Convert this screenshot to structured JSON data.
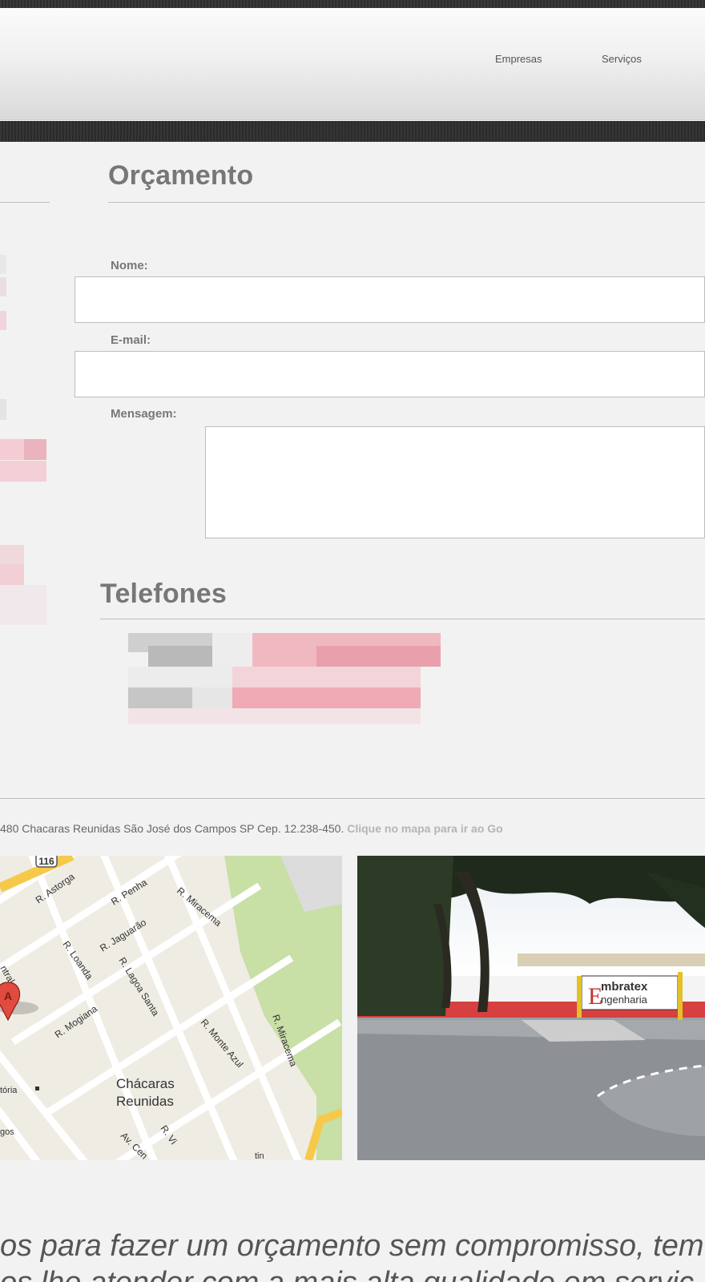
{
  "nav": {
    "items": [
      {
        "label": "Empresas"
      },
      {
        "label": "Serviços"
      }
    ]
  },
  "orcamento": {
    "title": "Orçamento",
    "name_label": "Nome:",
    "email_label": "E-mail:",
    "message_label": "Mensagem:",
    "name_value": "",
    "email_value": "",
    "message_value": ""
  },
  "telefones": {
    "title": "Telefones"
  },
  "footer": {
    "address": "480 Chacaras Reunidas São José dos Campos SP Cep. 12.238-450. ",
    "map_hint": "Clique no mapa para ir ao Go"
  },
  "map": {
    "route_badge": "116",
    "marker_letter": "A",
    "area_name_line1": "Chácaras",
    "area_name_line2": "Reunidas",
    "streets": [
      "R. Astorga",
      "R. Penha",
      "R. Miracema",
      "R. Loanda",
      "R. Jaguarão",
      "R. Lagoa Santa",
      "R. Mogiana",
      "R. Monte Azul",
      "R. Miracema",
      "R. Vi",
      "Av. Cen",
      "ntral",
      "tória",
      "gos",
      "tin"
    ]
  },
  "photo": {
    "sign_line1": "mbratex",
    "sign_line2": "ngenharia",
    "sign_initial": "E"
  },
  "tagline": {
    "line1": "os para fazer um orçamento sem compromisso, tem",
    "line2": "os lhe atender com a mais alta qualidade em servic"
  },
  "colors": {
    "blur_red": "#e79aa6",
    "blur_grey": "#c9c9c9",
    "map_road": "#ffffff",
    "map_park": "#c8dfa6",
    "highway": "#f6c94a",
    "marker": "#e04a3f"
  }
}
